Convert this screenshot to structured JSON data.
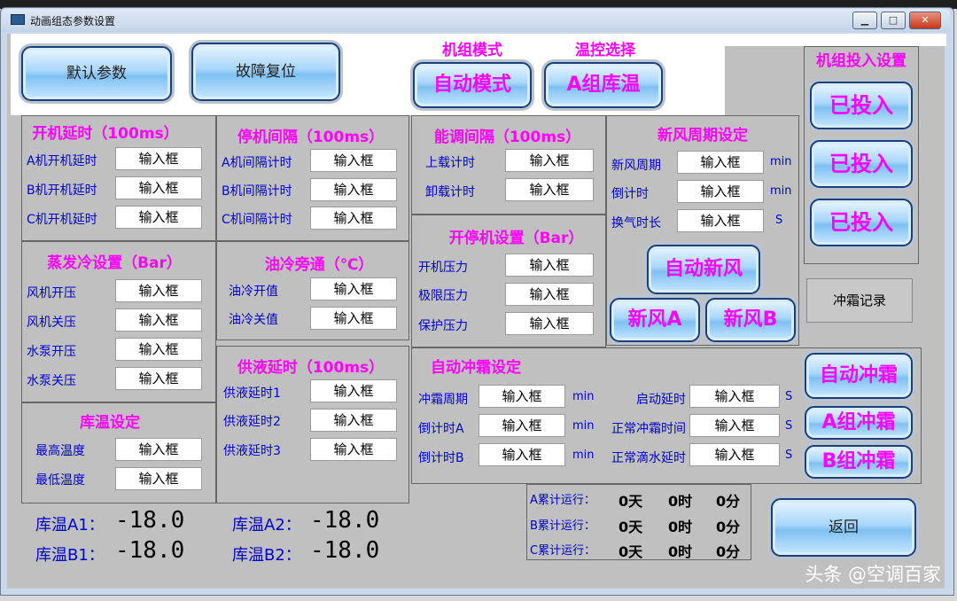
{
  "window": {
    "title": "动画组态参数设置"
  },
  "top_buttons": {
    "default_params": "默认参数",
    "fault_reset": "故障复位"
  },
  "mode": {
    "unit_mode_title": "机组模式",
    "temp_select_title": "温控选择",
    "unit_mode_value": "自动模式",
    "temp_select_value": "A组库温"
  },
  "unit_input": {
    "title": "机组投入设置",
    "buttons": [
      "已投入",
      "已投入",
      "已投入"
    ]
  },
  "start_delay": {
    "title": "开机延时（100ms）",
    "rows": [
      {
        "label": "A机开机延时",
        "value": "输入框"
      },
      {
        "label": "B机开机延时",
        "value": "输入框"
      },
      {
        "label": "C机开机延时",
        "value": "输入框"
      }
    ]
  },
  "stop_interval": {
    "title": "停机间隔（100ms）",
    "rows": [
      {
        "label": "A机间隔计时",
        "value": "输入框"
      },
      {
        "label": "B机间隔计时",
        "value": "输入框"
      },
      {
        "label": "C机间隔计时",
        "value": "输入框"
      }
    ]
  },
  "capacity_interval": {
    "title": "能调间隔（100ms）",
    "rows": [
      {
        "label": "上载计时",
        "value": "输入框"
      },
      {
        "label": "卸载计时",
        "value": "输入框"
      }
    ]
  },
  "fresh_air": {
    "title": "新风周期设定",
    "rows": [
      {
        "label": "新风周期",
        "value": "输入框",
        "unit": "min"
      },
      {
        "label": "倒计时",
        "value": "输入框",
        "unit": "min"
      },
      {
        "label": "换气时长",
        "value": "输入框",
        "unit": "S"
      }
    ],
    "auto_button": "自动新风",
    "a_button": "新风A",
    "b_button": "新风B"
  },
  "evap_cond": {
    "title": "蒸发冷设置（Bar）",
    "rows": [
      {
        "label": "风机开压",
        "value": "输入框"
      },
      {
        "label": "风机关压",
        "value": "输入框"
      },
      {
        "label": "水泵开压",
        "value": "输入框"
      },
      {
        "label": "水泵关压",
        "value": "输入框"
      }
    ]
  },
  "oil_bypass": {
    "title": "油冷旁通（℃）",
    "rows": [
      {
        "label": "油冷开值",
        "value": "输入框"
      },
      {
        "label": "油冷关值",
        "value": "输入框"
      }
    ]
  },
  "start_stop": {
    "title": "开停机设置（Bar）",
    "rows": [
      {
        "label": "开机压力",
        "value": "输入框"
      },
      {
        "label": "极限压力",
        "value": "输入框"
      },
      {
        "label": "保护压力",
        "value": "输入框"
      }
    ]
  },
  "defrost_record": "冲霜记录",
  "liquid_delay": {
    "title": "供液延时（100ms）",
    "rows": [
      {
        "label": "供液延时1",
        "value": "输入框"
      },
      {
        "label": "供液延时2",
        "value": "输入框"
      },
      {
        "label": "供液延时3",
        "value": "输入框"
      }
    ]
  },
  "auto_defrost": {
    "title": "自动冲霜设定",
    "left_rows": [
      {
        "label": "冲霜周期",
        "value": "输入框",
        "unit": "min"
      },
      {
        "label": "倒计时A",
        "value": "输入框",
        "unit": "min"
      },
      {
        "label": "倒计时B",
        "value": "输入框",
        "unit": "min"
      }
    ],
    "right_rows": [
      {
        "label": "启动延时",
        "value": "输入框",
        "unit": "S"
      },
      {
        "label": "正常冲霜时间",
        "value": "输入框",
        "unit": "S"
      },
      {
        "label": "正常滴水延时",
        "value": "输入框",
        "unit": "S"
      }
    ],
    "buttons": [
      "自动冲霜",
      "A组冲霜",
      "B组冲霜"
    ]
  },
  "store_temp": {
    "title": "库温设定",
    "rows": [
      {
        "label": "最高温度",
        "value": "输入框"
      },
      {
        "label": "最低温度",
        "value": "输入框"
      }
    ]
  },
  "temps": [
    {
      "label": "库温A1：",
      "value": "-18.0"
    },
    {
      "label": "库温A2：",
      "value": "-18.0"
    },
    {
      "label": "库温B1：",
      "value": "-18.0"
    },
    {
      "label": "库温B2：",
      "value": "-18.0"
    }
  ],
  "runtime": {
    "rows": [
      {
        "label": "A累计运行：",
        "days": "0天",
        "hours": "0时",
        "minutes": "0分"
      },
      {
        "label": "B累计运行：",
        "days": "0天",
        "hours": "0时",
        "minutes": "0分"
      },
      {
        "label": "C累计运行：",
        "days": "0天",
        "hours": "0时",
        "minutes": "0分"
      }
    ]
  },
  "return_button": "返回",
  "watermark": "头条 @空调百家"
}
